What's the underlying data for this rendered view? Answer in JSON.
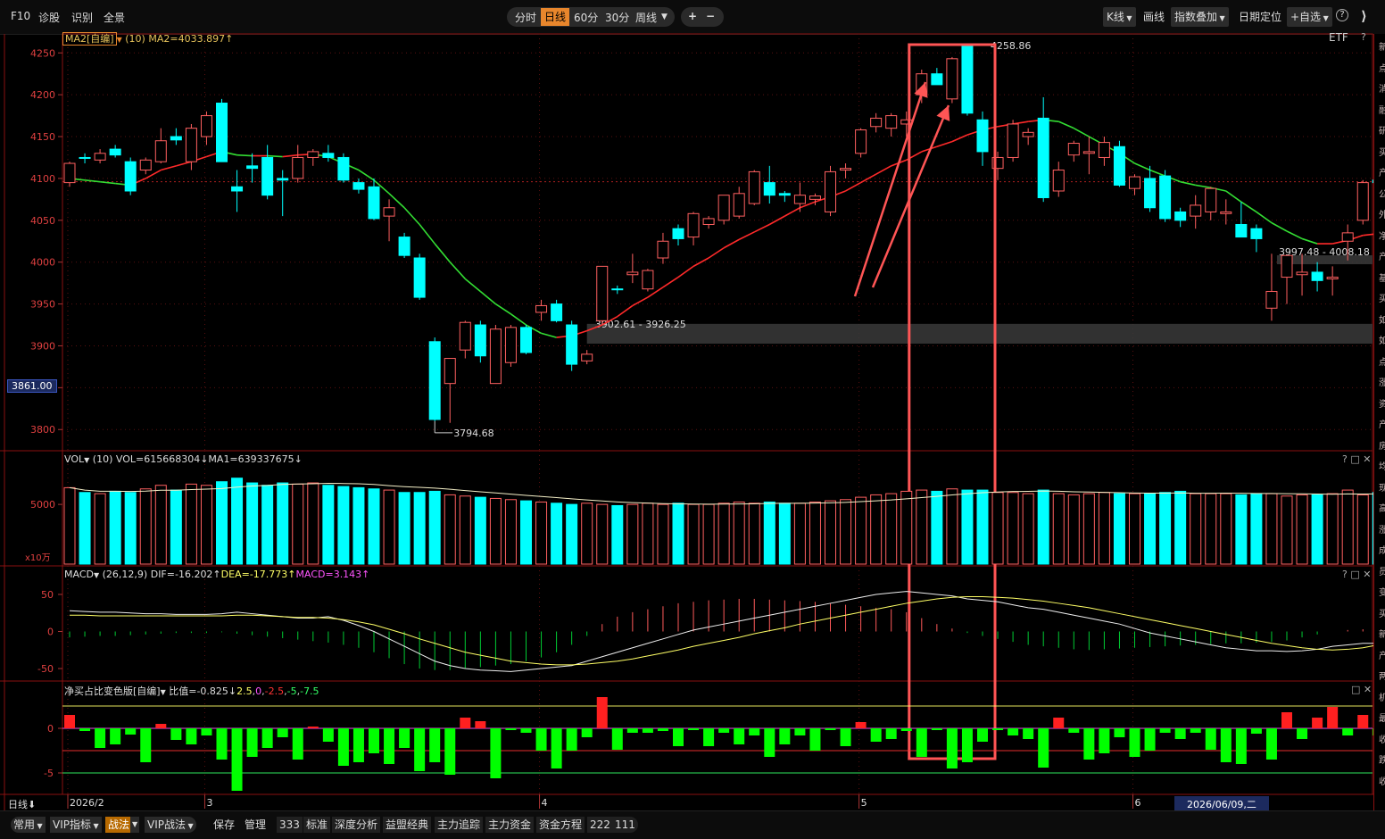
{
  "toolbar": {
    "left": [
      "F10",
      "诊股",
      "识别",
      "全景"
    ],
    "periods": [
      "分时",
      "日线",
      "60分",
      "30分",
      "周线"
    ],
    "active_period": "日线",
    "zoom_in": "+",
    "zoom_out": "−",
    "right": {
      "kline": "K线",
      "draw": "画线",
      "overlay": "指数叠加",
      "date_locate": "日期定位",
      "add_watch": "+自选",
      "help": "?",
      "collapse": "⟩"
    }
  },
  "colors": {
    "up": "#ff6060",
    "down": "#00ffff",
    "ma_up": "#ff2a2a",
    "ma_down": "#33dd33",
    "highlight_box": "#ff5555",
    "macd_pos": "#ff5a5a",
    "macd_neg": "#00cc33",
    "net_buy_pos": "#ff2020",
    "net_buy_neg": "#00ff00"
  },
  "price_panel": {
    "indicator_name": "MA2[自编]",
    "indicator_param": "(10)",
    "indicator_value": "MA2=4033.897↑",
    "etf_label": "ETF",
    "help": "?",
    "y_ticks": [
      "4250",
      "4200",
      "4150",
      "4100",
      "4050",
      "4000",
      "3950",
      "3900",
      "3850",
      "3800"
    ],
    "current_price_tag": "3861.00",
    "high_label": "4258.86",
    "low_label": "3794.68",
    "gap1_label": "3902.61 - 3926.25",
    "gap2_label": "3997.48 - 4008.18"
  },
  "vol_panel": {
    "name": "VOL",
    "param": "(10)",
    "value": "VOL=615668304↓",
    "ma": "MA1=639337675↓",
    "y_tick": "5000",
    "unit": "x10万",
    "controls": "? □ ✕"
  },
  "macd_panel": {
    "name": "MACD",
    "param": "(26,12,9)",
    "dif": "DIF=-16.202↑",
    "dea": "DEA=-17.773↑",
    "macd": "MACD=3.143↑",
    "y_ticks": [
      "50",
      "0",
      "-50"
    ],
    "controls": "? □ ✕"
  },
  "netbuy_panel": {
    "name": "净买占比变色版[自编]",
    "value": "比值=-0.825↓",
    "levels": [
      "2.5",
      "0",
      "-2.5",
      "-5",
      "-7.5"
    ],
    "y_ticks": [
      "0",
      "-5"
    ],
    "controls": "□ ✕"
  },
  "x_axis": {
    "period_label": "日线",
    "labels": [
      "2026/2",
      "3",
      "4",
      "5",
      "6"
    ],
    "cursor_date": "2026/06/09,二"
  },
  "right_strip_chars": [
    "新",
    "点",
    "消",
    "融",
    "研",
    "买",
    "产",
    "公",
    "外",
    "净",
    "产",
    "基",
    "买",
    "如",
    "如",
    "点",
    "涨",
    "资",
    "产",
    "房",
    "均",
    "现",
    "高",
    "涨",
    "成",
    "员",
    "变",
    "买",
    "新",
    "产",
    "两",
    "机",
    "最",
    "收",
    "跌",
    "收"
  ],
  "bottombar": {
    "items": [
      "常用",
      "VIP指标",
      "战法",
      "VIP战法",
      "保存",
      "管理",
      "333",
      "标准",
      "深度分析",
      "益盟经典",
      "主力追踪",
      "主力资金",
      "资金方程",
      "222",
      "111"
    ],
    "selected": "战法"
  },
  "chart_data": {
    "type": "candlestick",
    "candles": [
      {
        "o": 4095,
        "h": 4120,
        "l": 4090,
        "c": 4118
      },
      {
        "o": 4125,
        "h": 4130,
        "l": 4118,
        "c": 4124
      },
      {
        "o": 4122,
        "h": 4135,
        "l": 4118,
        "c": 4130
      },
      {
        "o": 4135,
        "h": 4140,
        "l": 4125,
        "c": 4128
      },
      {
        "o": 4120,
        "h": 4125,
        "l": 4080,
        "c": 4085
      },
      {
        "o": 4110,
        "h": 4125,
        "l": 4105,
        "c": 4122
      },
      {
        "o": 4120,
        "h": 4160,
        "l": 4118,
        "c": 4145
      },
      {
        "o": 4150,
        "h": 4160,
        "l": 4140,
        "c": 4146
      },
      {
        "o": 4120,
        "h": 4165,
        "l": 4110,
        "c": 4160
      },
      {
        "o": 4150,
        "h": 4180,
        "l": 4140,
        "c": 4175
      },
      {
        "o": 4190,
        "h": 4195,
        "l": 4120,
        "c": 4120
      },
      {
        "o": 4090,
        "h": 4110,
        "l": 4060,
        "c": 4085
      },
      {
        "o": 4115,
        "h": 4130,
        "l": 4095,
        "c": 4112
      },
      {
        "o": 4125,
        "h": 4140,
        "l": 4075,
        "c": 4080
      },
      {
        "o": 4100,
        "h": 4110,
        "l": 4055,
        "c": 4098
      },
      {
        "o": 4100,
        "h": 4140,
        "l": 4095,
        "c": 4125
      },
      {
        "o": 4125,
        "h": 4135,
        "l": 4115,
        "c": 4132
      },
      {
        "o": 4130,
        "h": 4140,
        "l": 4120,
        "c": 4125
      },
      {
        "o": 4125,
        "h": 4130,
        "l": 4095,
        "c": 4098
      },
      {
        "o": 4095,
        "h": 4100,
        "l": 4082,
        "c": 4087
      },
      {
        "o": 4090,
        "h": 4100,
        "l": 4050,
        "c": 4052
      },
      {
        "o": 4055,
        "h": 4075,
        "l": 4025,
        "c": 4065
      },
      {
        "o": 4030,
        "h": 4035,
        "l": 4005,
        "c": 4008
      },
      {
        "o": 4005,
        "h": 4010,
        "l": 3955,
        "c": 3958
      },
      {
        "o": 3905,
        "h": 3910,
        "l": 3810,
        "c": 3812
      },
      {
        "o": 3855,
        "h": 3885,
        "l": 3808,
        "c": 3885
      },
      {
        "o": 3895,
        "h": 3930,
        "l": 3885,
        "c": 3928
      },
      {
        "o": 3925,
        "h": 3930,
        "l": 3880,
        "c": 3888
      },
      {
        "o": 3855,
        "h": 3925,
        "l": 3855,
        "c": 3920
      },
      {
        "o": 3880,
        "h": 3925,
        "l": 3875,
        "c": 3922
      },
      {
        "o": 3922,
        "h": 3925,
        "l": 3890,
        "c": 3892
      },
      {
        "o": 3940,
        "h": 3955,
        "l": 3930,
        "c": 3948
      },
      {
        "o": 3950,
        "h": 3955,
        "l": 3928,
        "c": 3930
      },
      {
        "o": 3925,
        "h": 3930,
        "l": 3870,
        "c": 3878
      },
      {
        "o": 3882,
        "h": 3895,
        "l": 3878,
        "c": 3890
      },
      {
        "o": 3930,
        "h": 3995,
        "l": 3925,
        "c": 3995
      },
      {
        "o": 3968,
        "h": 3972,
        "l": 3962,
        "c": 3967
      },
      {
        "o": 3985,
        "h": 4010,
        "l": 3975,
        "c": 3988
      },
      {
        "o": 3968,
        "h": 3992,
        "l": 3965,
        "c": 3990
      },
      {
        "o": 4005,
        "h": 4035,
        "l": 3998,
        "c": 4025
      },
      {
        "o": 4040,
        "h": 4045,
        "l": 4020,
        "c": 4028
      },
      {
        "o": 4030,
        "h": 4060,
        "l": 4020,
        "c": 4058
      },
      {
        "o": 4045,
        "h": 4055,
        "l": 4040,
        "c": 4052
      },
      {
        "o": 4050,
        "h": 4075,
        "l": 4045,
        "c": 4080
      },
      {
        "o": 4055,
        "h": 4090,
        "l": 4052,
        "c": 4082
      },
      {
        "o": 4070,
        "h": 4110,
        "l": 4068,
        "c": 4108
      },
      {
        "o": 4095,
        "h": 4115,
        "l": 4070,
        "c": 4080
      },
      {
        "o": 4082,
        "h": 4085,
        "l": 4072,
        "c": 4080
      },
      {
        "o": 4070,
        "h": 4095,
        "l": 4060,
        "c": 4080
      },
      {
        "o": 4075,
        "h": 4082,
        "l": 4068,
        "c": 4079
      },
      {
        "o": 4060,
        "h": 4115,
        "l": 4055,
        "c": 4108
      },
      {
        "o": 4110,
        "h": 4118,
        "l": 4100,
        "c": 4112
      },
      {
        "o": 4130,
        "h": 4160,
        "l": 4125,
        "c": 4158
      },
      {
        "o": 4162,
        "h": 4178,
        "l": 4155,
        "c": 4172
      },
      {
        "o": 4160,
        "h": 4178,
        "l": 4150,
        "c": 4175
      },
      {
        "o": 4165,
        "h": 4180,
        "l": 4150,
        "c": 4170
      },
      {
        "o": 4200,
        "h": 4230,
        "l": 4190,
        "c": 4225
      },
      {
        "o": 4225,
        "h": 4232,
        "l": 4212,
        "c": 4212
      },
      {
        "o": 4195,
        "h": 4245,
        "l": 4190,
        "c": 4243
      },
      {
        "o": 4258,
        "h": 4259,
        "l": 4175,
        "c": 4178
      },
      {
        "o": 4170,
        "h": 4180,
        "l": 4115,
        "c": 4132
      },
      {
        "o": 4112,
        "h": 4132,
        "l": 4098,
        "c": 4125
      },
      {
        "o": 4125,
        "h": 4170,
        "l": 4120,
        "c": 4165
      },
      {
        "o": 4150,
        "h": 4160,
        "l": 4140,
        "c": 4155
      },
      {
        "o": 4172,
        "h": 4197,
        "l": 4072,
        "c": 4077
      },
      {
        "o": 4085,
        "h": 4120,
        "l": 4078,
        "c": 4110
      },
      {
        "o": 4128,
        "h": 4145,
        "l": 4120,
        "c": 4142
      },
      {
        "o": 4130,
        "h": 4150,
        "l": 4105,
        "c": 4132
      },
      {
        "o": 4125,
        "h": 4150,
        "l": 4115,
        "c": 4143
      },
      {
        "o": 4138,
        "h": 4145,
        "l": 4090,
        "c": 4092
      },
      {
        "o": 4088,
        "h": 4105,
        "l": 4080,
        "c": 4102
      },
      {
        "o": 4100,
        "h": 4115,
        "l": 4060,
        "c": 4065
      },
      {
        "o": 4103,
        "h": 4110,
        "l": 4048,
        "c": 4052
      },
      {
        "o": 4060,
        "h": 4065,
        "l": 4042,
        "c": 4050
      },
      {
        "o": 4055,
        "h": 4080,
        "l": 4040,
        "c": 4068
      },
      {
        "o": 4060,
        "h": 4090,
        "l": 4050,
        "c": 4088
      },
      {
        "o": 4058,
        "h": 4075,
        "l": 4045,
        "c": 4060
      },
      {
        "o": 4045,
        "h": 4072,
        "l": 4030,
        "c": 4030
      },
      {
        "o": 4040,
        "h": 4045,
        "l": 4012,
        "c": 4028
      },
      {
        "o": 3945,
        "h": 4010,
        "l": 3930,
        "c": 3965
      },
      {
        "o": 3982,
        "h": 4008,
        "l": 3950,
        "c": 4008
      },
      {
        "o": 3985,
        "h": 4010,
        "l": 3960,
        "c": 3988
      },
      {
        "o": 3988,
        "h": 4000,
        "l": 3965,
        "c": 3978
      },
      {
        "o": 3980,
        "h": 3995,
        "l": 3960,
        "c": 3982
      },
      {
        "o": 4025,
        "h": 4045,
        "l": 4002,
        "c": 4035
      },
      {
        "o": 4050,
        "h": 4098,
        "l": 4045,
        "c": 4095
      },
      {
        "o": 4098,
        "h": 4102,
        "l": 4080,
        "c": 4095
      }
    ],
    "ma": [
      4100,
      4098,
      4096,
      4094,
      4092,
      4100,
      4110,
      4115,
      4120,
      4126,
      4132,
      4128,
      4127,
      4127,
      4126,
      4128,
      4129,
      4126,
      4118,
      4110,
      4098,
      4082,
      4065,
      4045,
      4022,
      4000,
      3980,
      3965,
      3950,
      3938,
      3925,
      3915,
      3910,
      3912,
      3918,
      3925,
      3935,
      3948,
      3958,
      3970,
      3982,
      3995,
      4005,
      4017,
      4027,
      4036,
      4045,
      4055,
      4065,
      4072,
      4078,
      4085,
      4095,
      4105,
      4115,
      4122,
      4132,
      4138,
      4144,
      4152,
      4158,
      4162,
      4165,
      4168,
      4170,
      4168,
      4160,
      4150,
      4140,
      4130,
      4118,
      4110,
      4103,
      4096,
      4092,
      4089,
      4085,
      4072,
      4060,
      4047,
      4037,
      4028,
      4022,
      4022,
      4026,
      4032,
      4034
    ],
    "volume_10w": [
      6400,
      6000,
      5900,
      6100,
      6000,
      6300,
      6600,
      6200,
      6700,
      6600,
      6900,
      7200,
      6800,
      6600,
      6800,
      6700,
      6800,
      6600,
      6500,
      6400,
      6300,
      6200,
      6000,
      6000,
      6100,
      5800,
      5700,
      5600,
      5500,
      5400,
      5300,
      5200,
      5100,
      5000,
      5100,
      5000,
      4900,
      5000,
      5100,
      5000,
      5100,
      5000,
      5000,
      5100,
      5200,
      5100,
      5200,
      5100,
      5100,
      5200,
      5300,
      5400,
      5600,
      5800,
      5900,
      6100,
      6200,
      6100,
      6300,
      6200,
      6200,
      6000,
      6000,
      5900,
      6200,
      5900,
      5800,
      5900,
      6000,
      5900,
      5900,
      5900,
      6000,
      6100,
      5900,
      5900,
      5900,
      5800,
      5900,
      5900,
      5700,
      5800,
      5800,
      5900,
      6200,
      5800,
      6000
    ],
    "macd": [
      -8,
      -7,
      -6,
      -6,
      -5,
      -4,
      -3,
      -2,
      -2,
      -2,
      -1,
      -3,
      -5,
      -7,
      -9,
      -11,
      -13,
      -15,
      -18,
      -22,
      -28,
      -36,
      -44,
      -50,
      -52,
      -52,
      -50,
      -48,
      -46,
      -44,
      -40,
      -35,
      -28,
      -18,
      -6,
      10,
      20,
      26,
      30,
      34,
      38,
      40,
      42,
      43,
      44,
      44,
      43,
      42,
      41,
      40,
      38,
      36,
      34,
      32,
      30,
      26,
      18,
      10,
      4,
      -2,
      -6,
      -10,
      -14,
      -18,
      -20,
      -22,
      -24,
      -25,
      -24,
      -23,
      -22,
      -21,
      -20,
      -19,
      -18,
      -17,
      -16,
      -16,
      -15,
      -14,
      -12,
      -8,
      -4,
      0,
      2,
      3,
      3
    ],
    "dif": [
      28,
      27,
      26,
      26,
      25,
      24,
      24,
      23,
      23,
      23,
      24,
      26,
      24,
      22,
      20,
      18,
      18,
      20,
      15,
      8,
      0,
      -10,
      -20,
      -30,
      -40,
      -46,
      -50,
      -52,
      -53,
      -54,
      -52,
      -50,
      -48,
      -46,
      -40,
      -34,
      -28,
      -22,
      -16,
      -10,
      -4,
      2,
      6,
      10,
      14,
      18,
      22,
      26,
      30,
      34,
      38,
      42,
      46,
      50,
      52,
      54,
      52,
      50,
      48,
      44,
      42,
      40,
      36,
      32,
      30,
      26,
      22,
      18,
      14,
      10,
      4,
      -2,
      -6,
      -10,
      -14,
      -18,
      -22,
      -24,
      -26,
      -26,
      -27,
      -26,
      -24,
      -20,
      -18,
      -16,
      -16
    ],
    "dea": [
      22,
      22,
      21,
      21,
      21,
      21,
      21,
      21,
      21,
      21,
      21,
      22,
      22,
      21,
      20,
      19,
      19,
      18,
      16,
      13,
      9,
      3,
      -3,
      -10,
      -16,
      -22,
      -28,
      -32,
      -36,
      -40,
      -42,
      -44,
      -45,
      -45,
      -44,
      -42,
      -40,
      -37,
      -33,
      -29,
      -25,
      -20,
      -16,
      -12,
      -8,
      -3,
      1,
      5,
      10,
      14,
      18,
      22,
      26,
      30,
      34,
      38,
      41,
      44,
      46,
      47,
      47,
      46,
      45,
      43,
      41,
      38,
      35,
      32,
      28,
      24,
      20,
      16,
      12,
      8,
      4,
      0,
      -4,
      -8,
      -12,
      -16,
      -19,
      -22,
      -24,
      -25,
      -24,
      -22,
      -18,
      -17
    ],
    "net_buy": [
      1.5,
      -0.3,
      -2.2,
      -1.8,
      -0.7,
      -3.8,
      0.5,
      -1.3,
      -1.8,
      -0.8,
      -3.5,
      -7,
      -3.2,
      -2.2,
      -1,
      -3.5,
      0.2,
      -1.5,
      -4.2,
      -3.8,
      -2.8,
      -4,
      -2.2,
      -4.8,
      -3.8,
      -5.2,
      1.2,
      0.8,
      -5.6,
      -0.2,
      -0.5,
      -2.5,
      -4.5,
      -2.5,
      -1,
      3.5,
      -2.4,
      -0.5,
      -0.5,
      -0.3,
      -2,
      -0.2,
      -2,
      -0.5,
      -1.8,
      -0.8,
      -3.2,
      -1.8,
      -0.8,
      -2.5,
      -0.2,
      -2,
      0.7,
      -1.5,
      -1.2,
      -0.3,
      -3.2,
      -0.2,
      -4.5,
      -3.8,
      -1.5,
      -0.2,
      -0.8,
      -1.2,
      -4.4,
      1.2,
      -0.5,
      -3.5,
      -2.8,
      -1,
      -3.2,
      -2.5,
      -0.5,
      -1.2,
      -0.5,
      -2.4,
      -3.8,
      -4,
      -0.6,
      -3.5,
      1.8,
      -1.2,
      1.2,
      2.4,
      -0.8,
      1.5,
      -0.8
    ],
    "x_label_index": {
      "2026/2": 0,
      "3": 9,
      "4": 31,
      "5": 52,
      "6": 70
    },
    "price_ylim": [
      3780,
      4262
    ],
    "gap_zones": [
      [
        3902.61,
        3926.25
      ],
      [
        3997.48,
        4008.18
      ]
    ],
    "highlight_range": [
      56,
      60
    ]
  }
}
